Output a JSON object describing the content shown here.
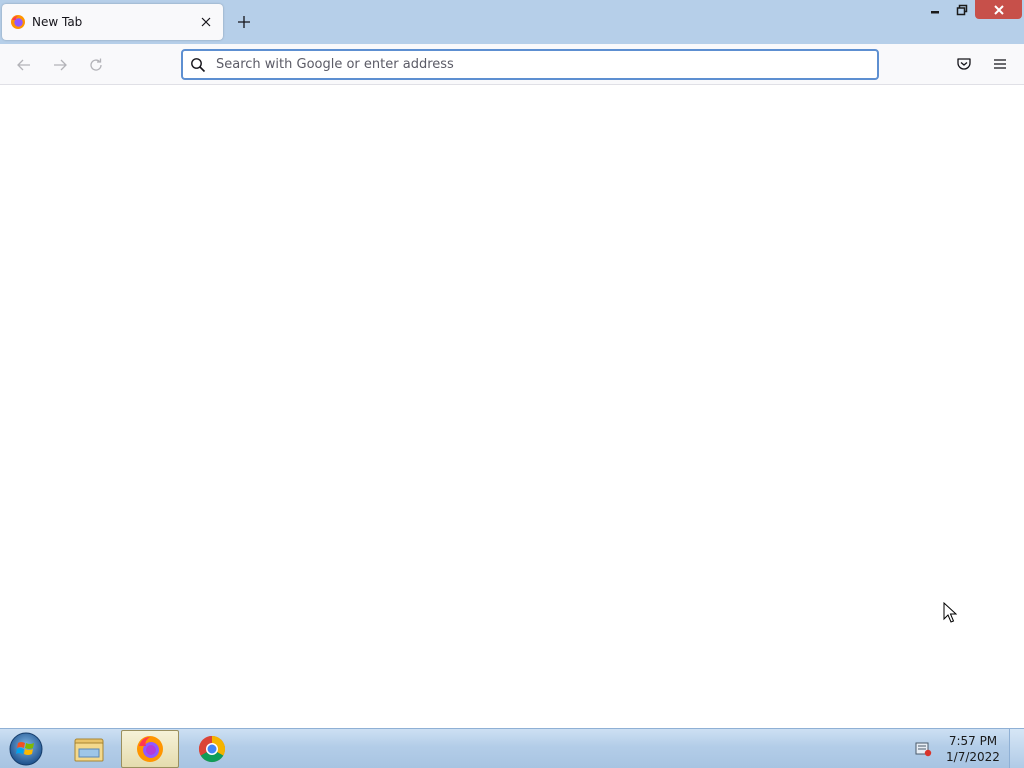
{
  "browser": {
    "tab": {
      "title": "New Tab",
      "favicon": "firefox-icon",
      "close_icon": "close-icon"
    },
    "new_tab_icon": "plus-icon",
    "window_controls": [
      "minimize-icon",
      "restore-icon",
      "close-icon"
    ],
    "nav_buttons": [
      "back-arrow-icon",
      "forward-arrow-icon",
      "reload-icon"
    ],
    "urlbar": {
      "placeholder": "Search with Google or enter address",
      "value": ""
    },
    "toolbar_right": [
      "pocket-icon",
      "hamburger-menu-icon"
    ]
  },
  "taskbar": {
    "start_icon": "windows-start-orb-icon",
    "items": [
      {
        "name": "file-explorer",
        "icon": "folder-icon",
        "active": false
      },
      {
        "name": "firefox",
        "icon": "firefox-icon",
        "active": true
      },
      {
        "name": "chrome",
        "icon": "chrome-icon",
        "active": false
      }
    ],
    "tray_icon": "action-center-icon",
    "clock": {
      "time": "7:57 PM",
      "date": "1/7/2022"
    }
  },
  "colors": {
    "titlebar": "#b6cfe9",
    "urlbar_focus_border": "#5d8fd1",
    "window_close": "#c7504a"
  }
}
